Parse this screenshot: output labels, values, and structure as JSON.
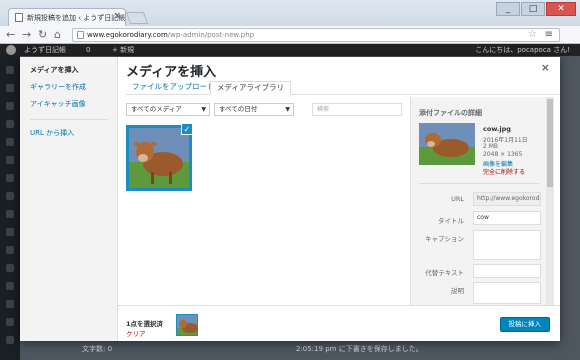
{
  "browser": {
    "tab_title": "新規投稿を追加 ‹ ようず日記帳",
    "url_host": "www.egokorodiary.com",
    "url_path": "/wp-admin/post-new.php",
    "window_minimize": "_",
    "window_maximize": "□",
    "window_close": "✕"
  },
  "adminbar": {
    "site_name": "ようず日記帳",
    "comments_count": "0",
    "new_label": "+ 新規",
    "greeting": "こんにちは、pocapoca さん!"
  },
  "modal": {
    "title": "メディアを挿入",
    "close": "×",
    "menu": [
      "メディアを挿入",
      "ギャラリーを作成",
      "アイキャッチ画像",
      "URL から挿入"
    ],
    "tabs": [
      "ファイルをアップロード",
      "メディアライブラリ"
    ],
    "filter_type": "すべてのメディア",
    "filter_date": "すべての日付",
    "search_placeholder": "検索",
    "details": {
      "heading": "添付ファイルの詳細",
      "filename": "cow.jpg",
      "date": "2016年1月11日",
      "size": "2 MB",
      "dimensions": "2048 × 1365",
      "edit_link": "画像を編集",
      "delete_link": "完全に削除する",
      "labels": {
        "url": "URL",
        "title": "タイトル",
        "caption": "キャプション",
        "alt": "代替テキスト",
        "description": "説明"
      },
      "url_value": "http://www.egokorodiary.",
      "title_value": "cow"
    },
    "footer": {
      "selected_count": "1点を選択済",
      "clear": "クリア",
      "insert_button": "投稿に挿入"
    }
  },
  "background": {
    "word_count": "文字数: 0",
    "draft_saved": "2:05:19 pm に下書きを保存しました。"
  },
  "colors": {
    "accent": "#0085ba",
    "selection": "#1e8cbe",
    "danger": "#a00000"
  }
}
